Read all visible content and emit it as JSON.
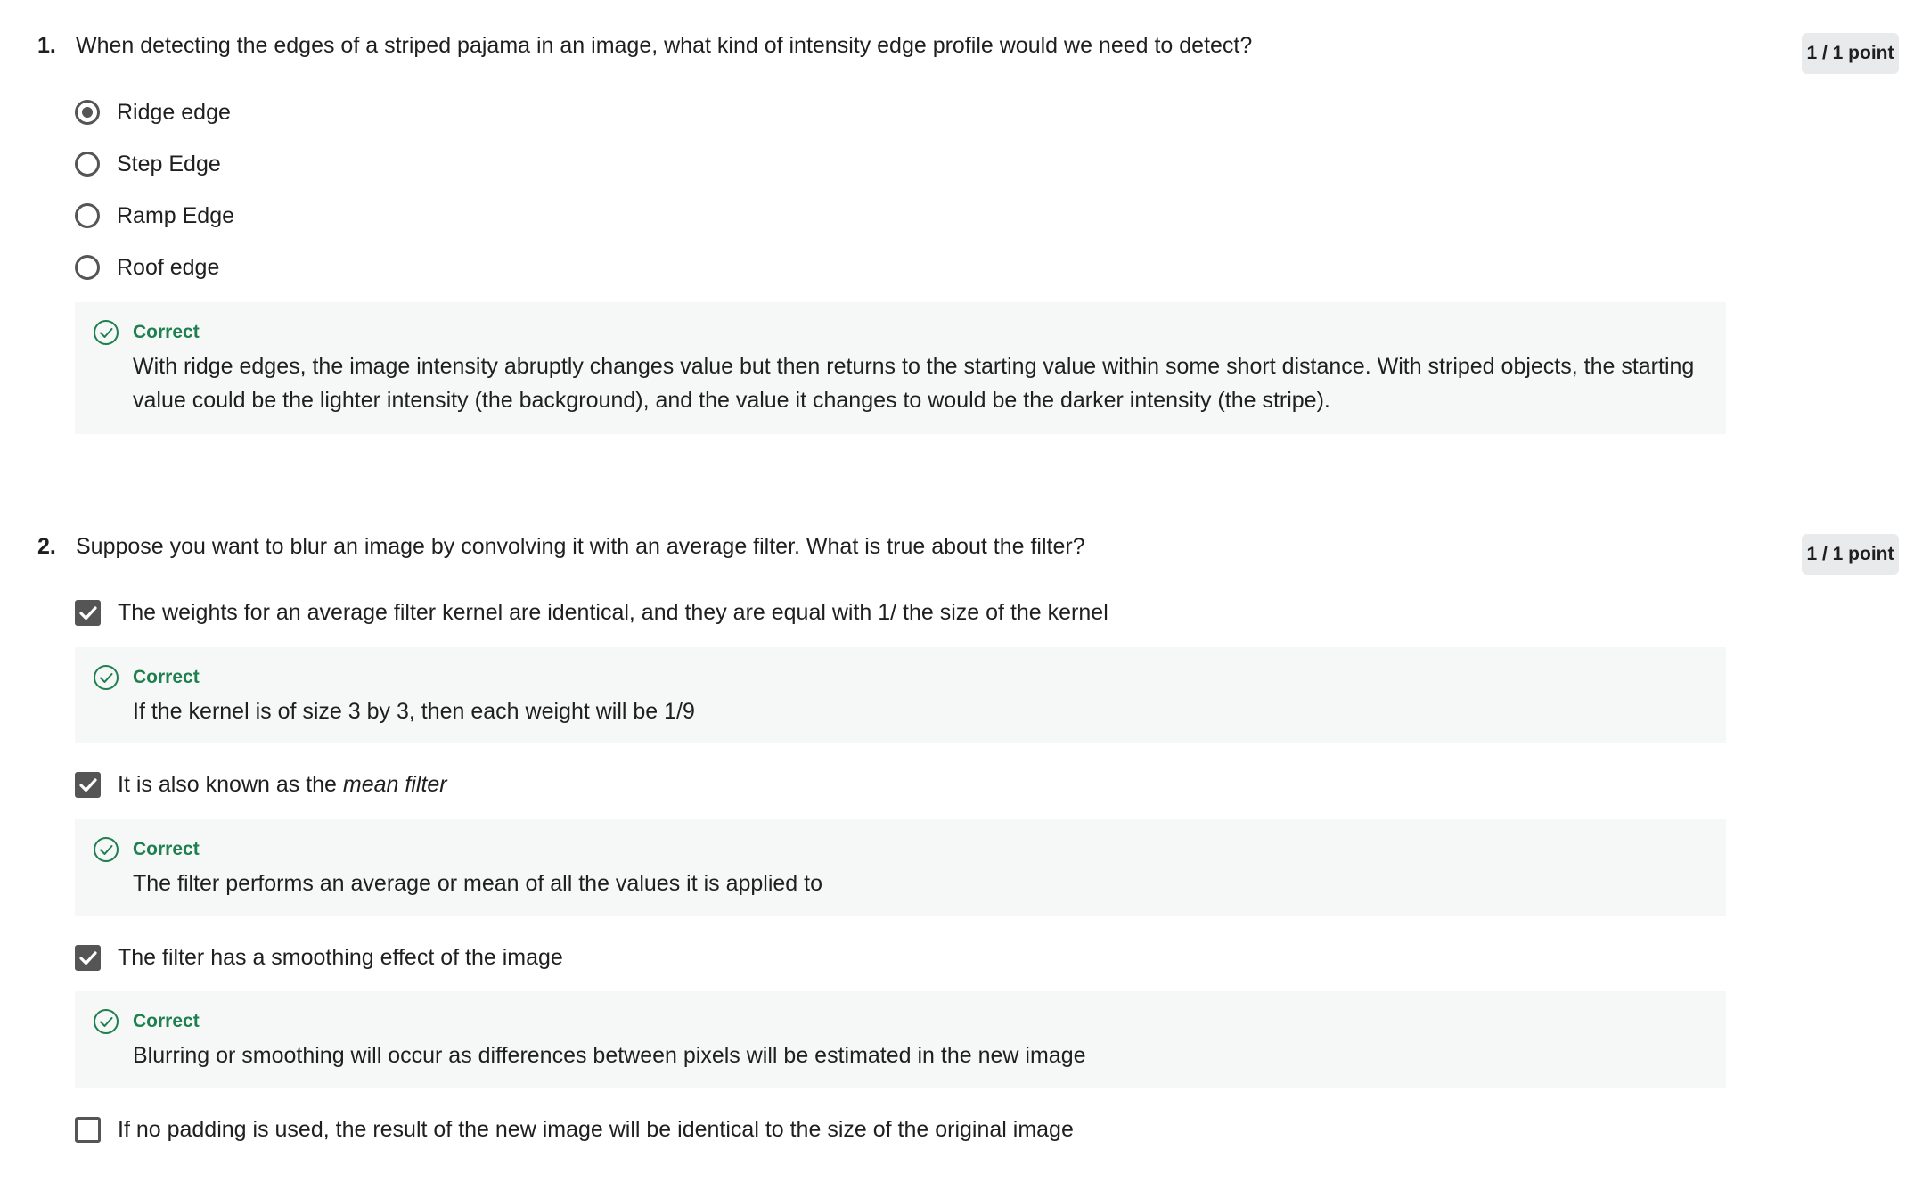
{
  "questions": [
    {
      "number": "1.",
      "text": "When detecting the edges of a striped pajama in an image, what kind of intensity edge profile would we need to detect?",
      "points": "1 / 1 point",
      "options": [
        {
          "label": "Ridge edge",
          "selected": true
        },
        {
          "label": "Step Edge",
          "selected": false
        },
        {
          "label": "Ramp Edge",
          "selected": false
        },
        {
          "label": "Roof edge",
          "selected": false
        }
      ],
      "feedback": {
        "title": "Correct",
        "text": "With ridge edges, the image intensity abruptly changes value but then returns to the starting value within some short distance. With striped objects, the starting value could be the lighter intensity (the background), and the value it changes to would be the darker intensity (the stripe)."
      }
    },
    {
      "number": "2.",
      "text": "Suppose you want to blur an image by convolving it with an average filter. What is true about the filter?",
      "points": "1 / 1 point",
      "options": [
        {
          "label": "The weights for an average filter kernel are identical, and they are equal with 1/ the size of the kernel",
          "checked": true,
          "feedback_title": "Correct",
          "feedback_text": "If the kernel is of size 3 by 3, then each weight will be 1/9"
        },
        {
          "label_prefix": "It is also known as the ",
          "label_emphasis": "mean filter",
          "checked": true,
          "feedback_title": "Correct",
          "feedback_text": "The filter performs an average or mean of all the values it is applied to"
        },
        {
          "label": "The filter has a smoothing effect of the image",
          "checked": true,
          "feedback_title": "Correct",
          "feedback_text": "Blurring or smoothing will occur as differences between pixels will be estimated in the new image"
        },
        {
          "label": "If no padding is used, the result of the new image will be identical to the size of the original image",
          "checked": false
        }
      ]
    }
  ],
  "colors": {
    "correct_green": "#1e7f4f",
    "feedback_bg": "#f5f8f7",
    "badge_bg": "#e8eaec",
    "control_gray": "#555555"
  },
  "icons": {
    "feedback": "check-circle-icon",
    "checkbox_checked": "checkmark-icon"
  }
}
